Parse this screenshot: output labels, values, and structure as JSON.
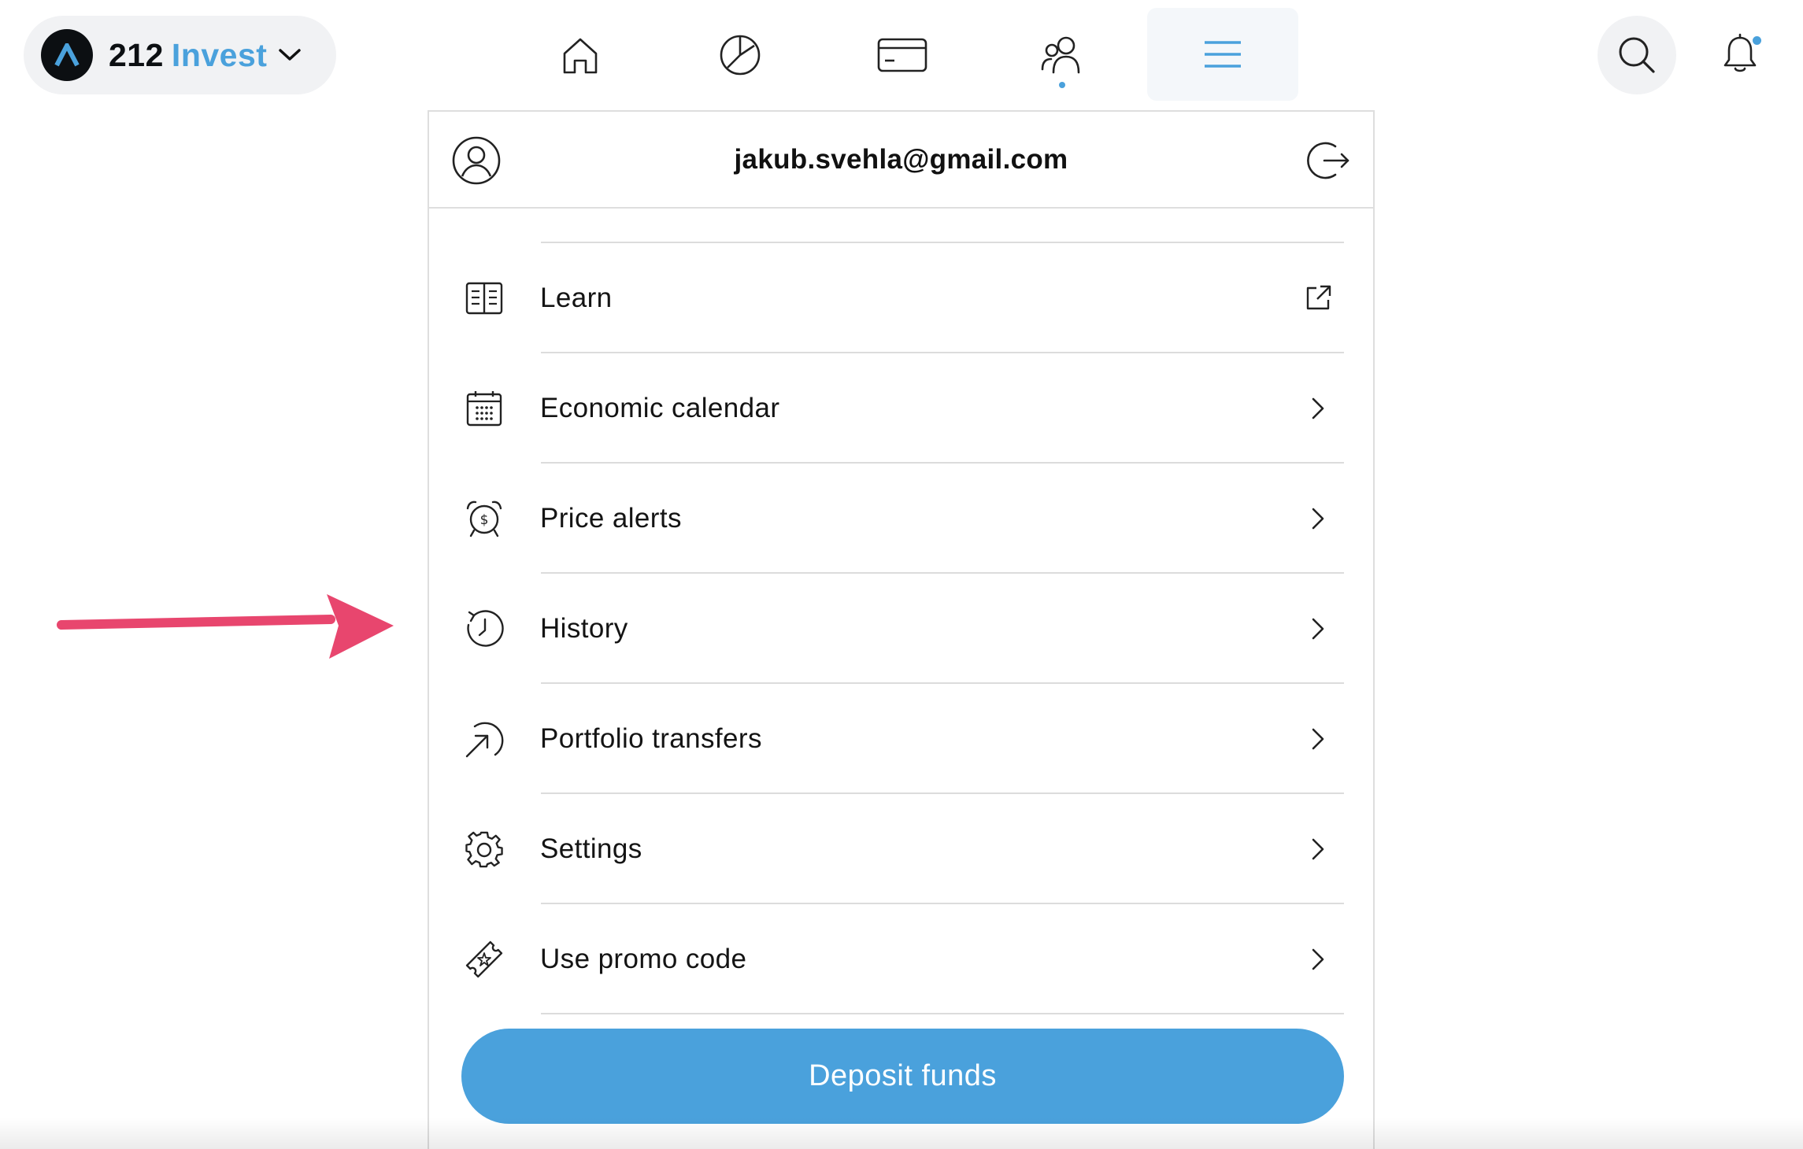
{
  "brand": {
    "number": "212",
    "word": "Invest",
    "accent_color": "#4aa1dc",
    "logo_icon": "arrow-up-logo-icon"
  },
  "nav": {
    "items": [
      {
        "name": "home",
        "icon": "home-icon"
      },
      {
        "name": "portfolio",
        "icon": "pie-chart-icon"
      },
      {
        "name": "cards",
        "icon": "card-icon"
      },
      {
        "name": "community",
        "icon": "people-icon",
        "has_dot": true
      },
      {
        "name": "menu",
        "icon": "hamburger-icon",
        "active": true
      }
    ],
    "search_icon": "search-icon",
    "notifications_icon": "bell-icon",
    "notifications_has_dot": true
  },
  "panel": {
    "user_email": "jakub.svehla@gmail.com",
    "user_icon": "user-circle-icon",
    "logout_icon": "logout-icon",
    "menu_items": [
      {
        "label": "Learn",
        "icon": "book-icon",
        "action": "external-link-icon"
      },
      {
        "label": "Economic calendar",
        "icon": "calendar-icon",
        "action": "chevron-right-icon"
      },
      {
        "label": "Price alerts",
        "icon": "alarm-clock-icon",
        "action": "chevron-right-icon"
      },
      {
        "label": "History",
        "icon": "history-icon",
        "action": "chevron-right-icon"
      },
      {
        "label": "Portfolio transfers",
        "icon": "transfer-icon",
        "action": "chevron-right-icon"
      },
      {
        "label": "Settings",
        "icon": "gear-icon",
        "action": "chevron-right-icon"
      },
      {
        "label": "Use promo code",
        "icon": "ticket-icon",
        "action": "chevron-right-icon"
      }
    ],
    "deposit_label": "Deposit funds"
  },
  "annotation": {
    "arrow_color": "#e8466e",
    "points_to": "History"
  }
}
